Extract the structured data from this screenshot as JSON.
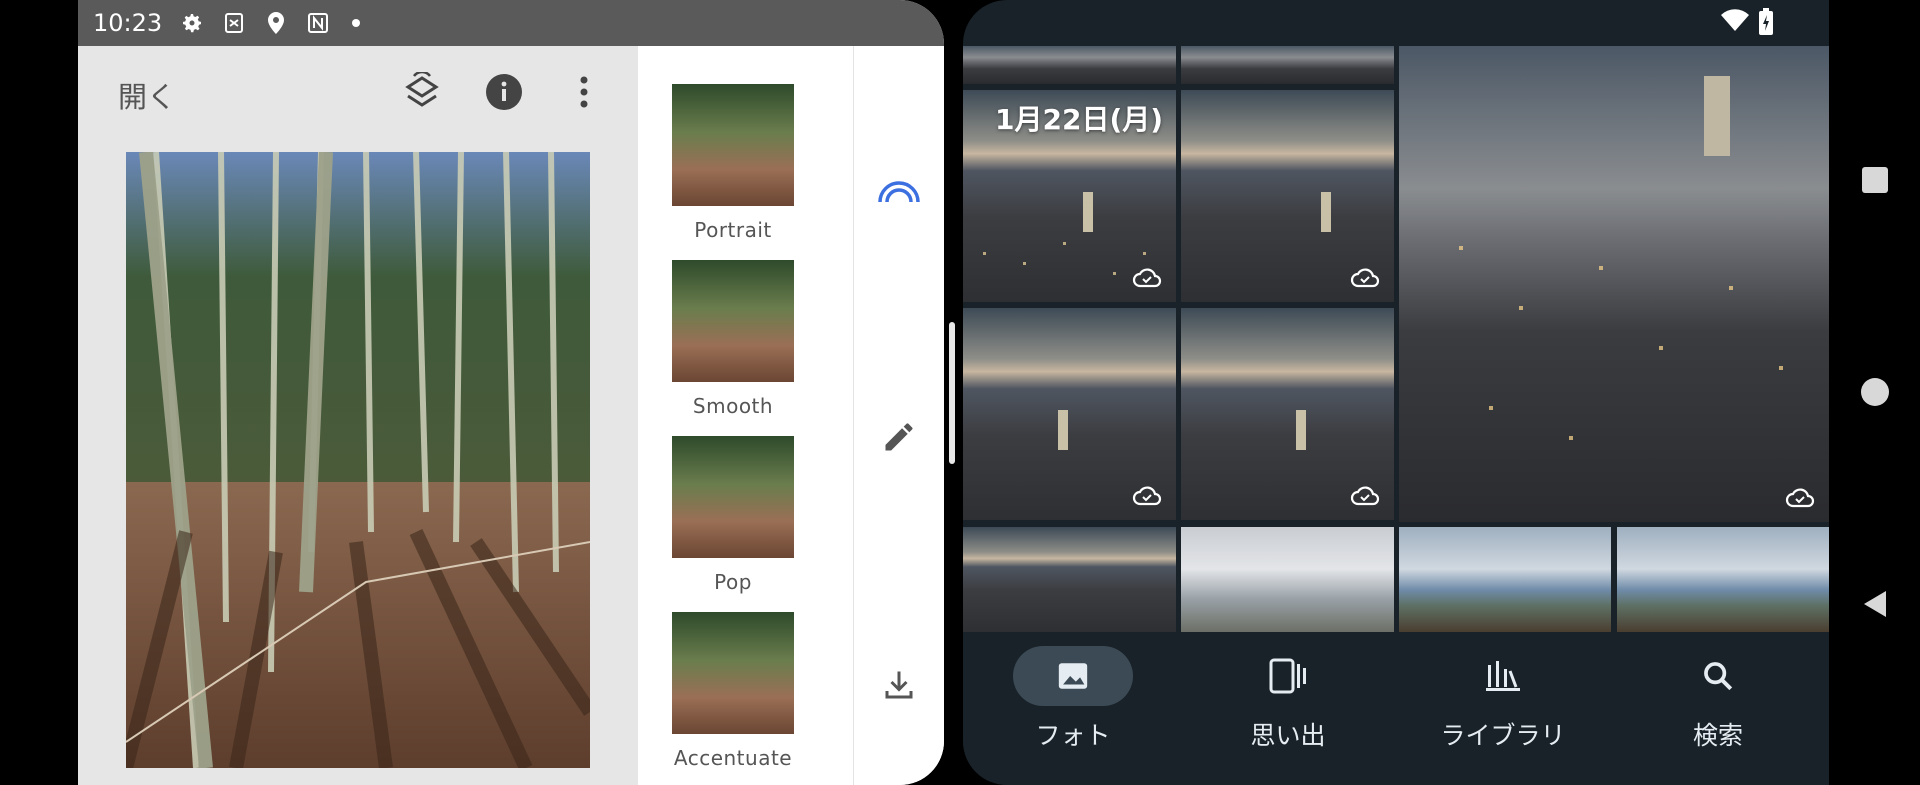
{
  "status_left": {
    "time": "10:23",
    "icons": [
      "gear-icon",
      "screenshot-icon",
      "location-icon",
      "nfc-icon",
      "notification-dot"
    ]
  },
  "status_right": {
    "icons": [
      "wifi-icon",
      "battery-charging-icon"
    ]
  },
  "editor": {
    "open_label": "開く",
    "toolbar_icons": [
      "compare-layers-icon",
      "info-icon",
      "more-vert-icon"
    ],
    "filters": [
      {
        "label": "Portrait"
      },
      {
        "label": "Smooth"
      },
      {
        "label": "Pop"
      },
      {
        "label": "Accentuate"
      }
    ],
    "side_actions": [
      "magic-arc-icon",
      "edit-pencil-icon",
      "download-icon"
    ]
  },
  "gallery": {
    "date_label": "1月22日(月)",
    "nav": [
      {
        "label": "フォト",
        "icon": "photo-icon",
        "active": true
      },
      {
        "label": "思い出",
        "icon": "memories-icon",
        "active": false
      },
      {
        "label": "ライブラリ",
        "icon": "library-icon",
        "active": false
      },
      {
        "label": "検索",
        "icon": "search-icon",
        "active": false
      }
    ]
  },
  "system_nav": [
    "recents-square-icon",
    "home-circle-icon",
    "back-triangle-icon"
  ],
  "colors": {
    "gallery_bg": "#182228",
    "accent_blue": "#3c6fe0",
    "status_left_bg": "#5a5a5a"
  }
}
